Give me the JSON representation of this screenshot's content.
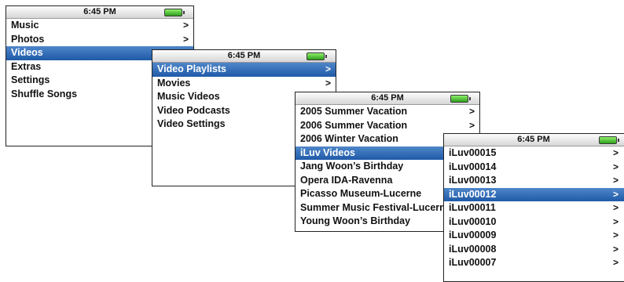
{
  "screens": [
    {
      "time": "6:45 PM",
      "items": [
        {
          "label": "Music",
          "arrow": true,
          "selected": false
        },
        {
          "label": "Photos",
          "arrow": true,
          "selected": false
        },
        {
          "label": "Videos",
          "arrow": false,
          "selected": true
        },
        {
          "label": "Extras",
          "arrow": false,
          "selected": false
        },
        {
          "label": "Settings",
          "arrow": false,
          "selected": false
        },
        {
          "label": "Shuffle Songs",
          "arrow": false,
          "selected": false
        }
      ]
    },
    {
      "time": "6:45 PM",
      "items": [
        {
          "label": "Video Playlists",
          "arrow": true,
          "selected": true
        },
        {
          "label": "Movies",
          "arrow": true,
          "selected": false
        },
        {
          "label": "Music Videos",
          "arrow": false,
          "selected": false
        },
        {
          "label": "Video Podcasts",
          "arrow": false,
          "selected": false
        },
        {
          "label": "Video Settings",
          "arrow": false,
          "selected": false
        }
      ]
    },
    {
      "time": "6:45 PM",
      "items": [
        {
          "label": "2005 Summer Vacation",
          "arrow": true,
          "selected": false
        },
        {
          "label": "2006 Summer Vacation",
          "arrow": true,
          "selected": false
        },
        {
          "label": "2006 Winter Vacation",
          "arrow": false,
          "selected": false
        },
        {
          "label": "iLuv Videos",
          "arrow": false,
          "selected": true
        },
        {
          "label": "Jang Woon’s Birthday",
          "arrow": false,
          "selected": false
        },
        {
          "label": "Opera IDA-Ravenna",
          "arrow": false,
          "selected": false
        },
        {
          "label": "Picasso Museum-Lucerne",
          "arrow": false,
          "selected": false
        },
        {
          "label": "Summer Music Festival-Lucerne",
          "arrow": false,
          "selected": false
        },
        {
          "label": "Young Woon’s Birthday",
          "arrow": false,
          "selected": false
        }
      ]
    },
    {
      "time": "6:45 PM",
      "items": [
        {
          "label": "iLuv00015",
          "arrow": true,
          "selected": false
        },
        {
          "label": "iLuv00014",
          "arrow": true,
          "selected": false
        },
        {
          "label": "iLuv00013",
          "arrow": true,
          "selected": false
        },
        {
          "label": "iLuv00012",
          "arrow": true,
          "selected": true
        },
        {
          "label": "iLuv00011",
          "arrow": true,
          "selected": false
        },
        {
          "label": "iLuv00010",
          "arrow": true,
          "selected": false
        },
        {
          "label": "iLuv00009",
          "arrow": true,
          "selected": false
        },
        {
          "label": "iLuv00008",
          "arrow": true,
          "selected": false
        },
        {
          "label": "iLuv00007",
          "arrow": true,
          "selected": false
        }
      ]
    }
  ],
  "icons": {
    "battery": "battery-icon",
    "arrow": "chevron-right-icon"
  },
  "colors": {
    "selection": "#2a63ad",
    "battery": "#3fbf2a",
    "border": "#222222"
  }
}
